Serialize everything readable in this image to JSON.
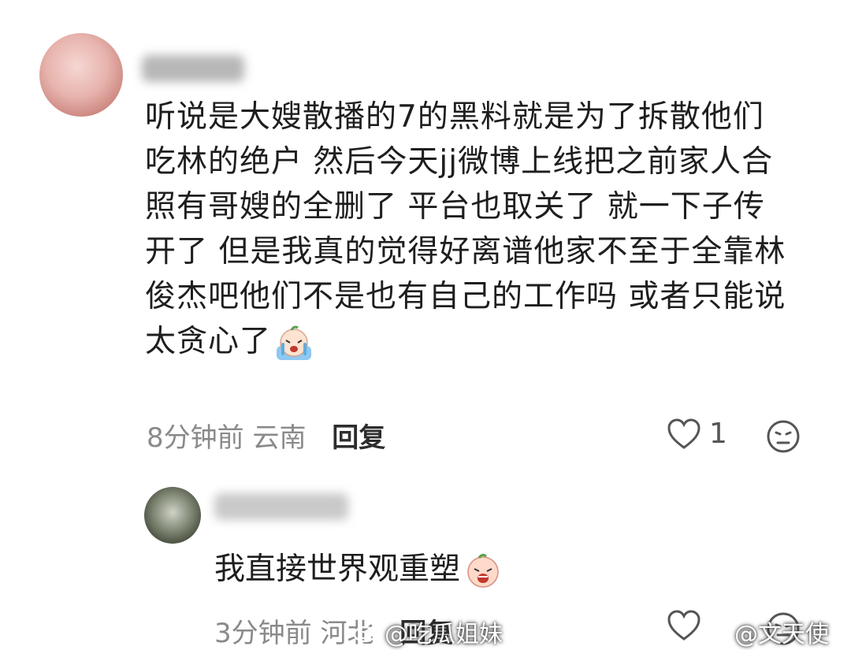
{
  "comment1": {
    "lines": [
      "听说是大嫂散播的7的黑料就是为了拆散他们",
      "吃林的绝户 然后今天jj微博上线把之前家人合",
      "照有哥嫂的全删了 平台也取关了 就一下子传",
      "开了 但是我真的觉得好离谱他家不至于全靠林",
      "俊杰吧他们不是也有自己的工作吗 或者只能说",
      "太贪心了"
    ],
    "emoji": "crying-emoji",
    "time": "8分钟前",
    "location": "云南",
    "reply_label": "回复",
    "like_count": "1"
  },
  "comment2": {
    "text": "我直接世界观重塑",
    "emoji": "crying-emoji",
    "time": "3分钟前",
    "location": "河北",
    "reply_label": "回复"
  },
  "watermarks": {
    "left": "@吃瓜姐妹",
    "right": "@文天使"
  },
  "colors": {
    "text": "#1e1e1e",
    "meta": "#8a8a8a",
    "background": "#ffffff"
  }
}
